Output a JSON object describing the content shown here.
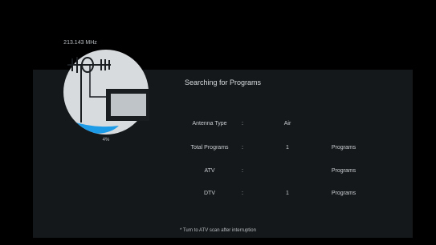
{
  "dialog": {
    "title": "Searching for Programs",
    "frequency": "213.143 MHz",
    "progress_label": "4%",
    "progress_value": 0.04,
    "note": "* Turn to ATV scan after interruption"
  },
  "rows": [
    {
      "label": "Antenna Type",
      "colon": ":",
      "value": "Air",
      "unit": ""
    },
    {
      "label": "Total Programs",
      "colon": ":",
      "value": "1",
      "unit": "Programs"
    },
    {
      "label": "ATV",
      "colon": ":",
      "value": "",
      "unit": "Programs"
    },
    {
      "label": "DTV",
      "colon": ":",
      "value": "1",
      "unit": "Programs"
    }
  ],
  "icons": {
    "scan": "antenna-tv-icon"
  },
  "colors": {
    "background": "#000000",
    "panel": "#15181b",
    "gauge": "#d7dbde",
    "progress": "#1e9be6"
  }
}
